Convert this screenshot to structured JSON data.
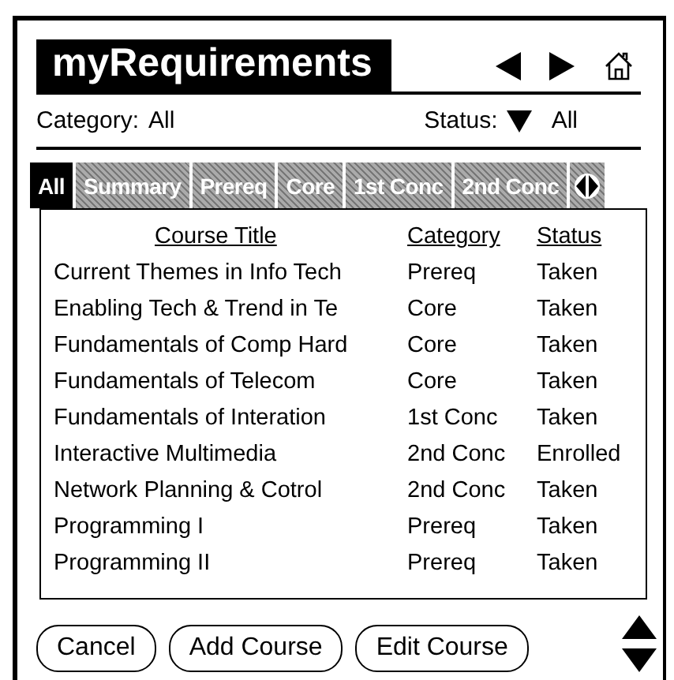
{
  "window": {
    "title": "myRequirements"
  },
  "filters": [
    {
      "label": "Category:",
      "value": "All",
      "kind": "plain"
    },
    {
      "label": "Status:",
      "value": "All",
      "kind": "dropdown"
    }
  ],
  "tabs": [
    {
      "label": "All",
      "selected": true
    },
    {
      "label": "Summary",
      "selected": false
    },
    {
      "label": "Prereq",
      "selected": false
    },
    {
      "label": "Core",
      "selected": false
    },
    {
      "label": "1st Conc",
      "selected": false
    },
    {
      "label": "2nd Conc",
      "selected": false
    }
  ],
  "table": {
    "columns": [
      "Course Title",
      "Category",
      "Status"
    ],
    "rows": [
      [
        "Current Themes in Info Tech",
        "Prereq",
        "Taken"
      ],
      [
        "Enabling Tech & Trend in Te",
        "Core",
        "Taken"
      ],
      [
        "Fundamentals of Comp Hard",
        "Core",
        "Taken"
      ],
      [
        "Fundamentals of Telecom",
        "Core",
        "Taken"
      ],
      [
        "Fundamentals of Interation",
        "1st Conc",
        "Taken"
      ],
      [
        "Interactive Multimedia",
        "2nd Conc",
        "Enrolled"
      ],
      [
        "Network Planning & Cotrol",
        "2nd Conc",
        "Taken"
      ],
      [
        "Programming I",
        "Prereq",
        "Taken"
      ],
      [
        "Programming II",
        "Prereq",
        "Taken"
      ]
    ]
  },
  "buttons": [
    "Cancel",
    "Add Course",
    "Edit Course"
  ]
}
